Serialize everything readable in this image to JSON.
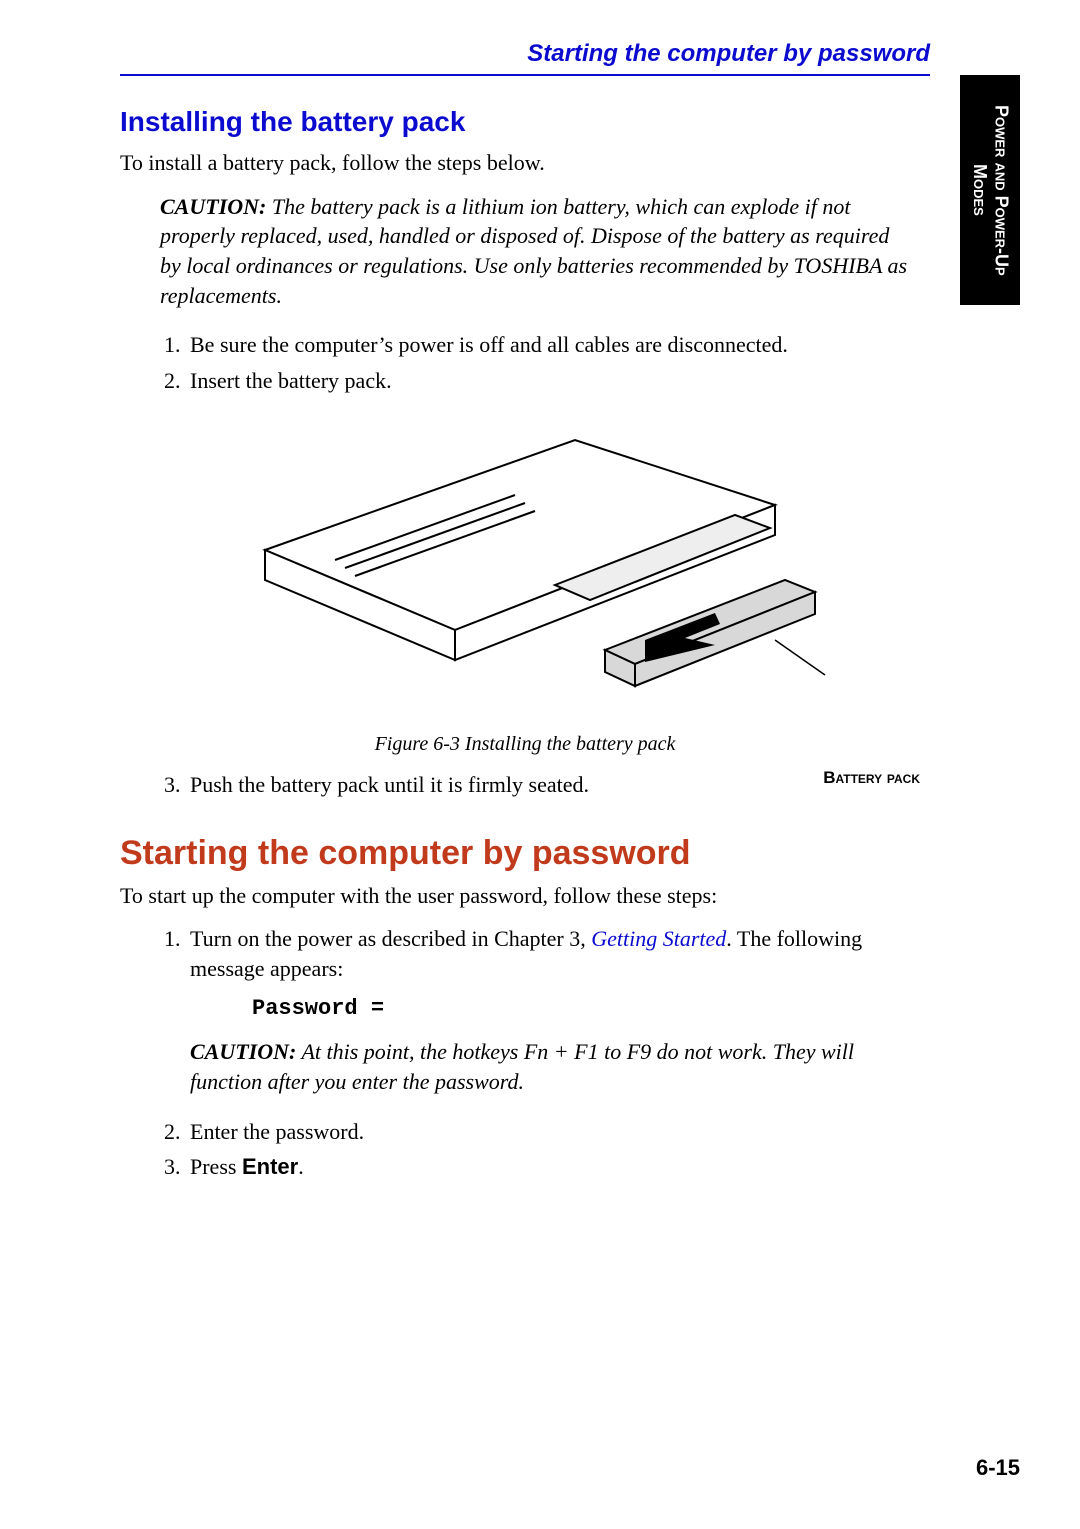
{
  "header": {
    "running_title": "Starting the computer by password",
    "side_tab": "Power and Power-Up Modes"
  },
  "section_install": {
    "heading": "Installing the battery pack",
    "intro": "To install a battery pack, follow the steps below.",
    "caution_lead": "CAUTION:",
    "caution_text": " The battery pack is a lithium ion battery, which can explode if not properly replaced, used, handled or disposed of. Dispose of the battery as required by local ordinances or regulations. Use only batteries recommended by TOSHIBA as replacements.",
    "steps_a": [
      "Be sure the computer’s power is off and all cables are disconnected.",
      "Insert the battery pack."
    ],
    "figure_label": "Battery pack",
    "figure_caption": "Figure 6-3 Installing the battery pack",
    "steps_b_start": 3,
    "steps_b": [
      "Push the battery pack until it is firmly seated."
    ]
  },
  "section_password": {
    "heading": "Starting the computer by password",
    "intro": "To start up the computer with the user password, follow these steps:",
    "step1_pre": "Turn on the power as described in Chapter 3, ",
    "step1_link": "Getting Started",
    "step1_post": ". The following message appears:",
    "code": "Password =",
    "caution_lead": "CAUTION:",
    "caution_text": " At this point, the hotkeys Fn + F1 to F9 do not work. They will function after you enter the password.",
    "step2": "Enter the password.",
    "step3_pre": "Press ",
    "step3_bold": "Enter",
    "step3_post": "."
  },
  "footer": {
    "page_number": "6-15"
  }
}
